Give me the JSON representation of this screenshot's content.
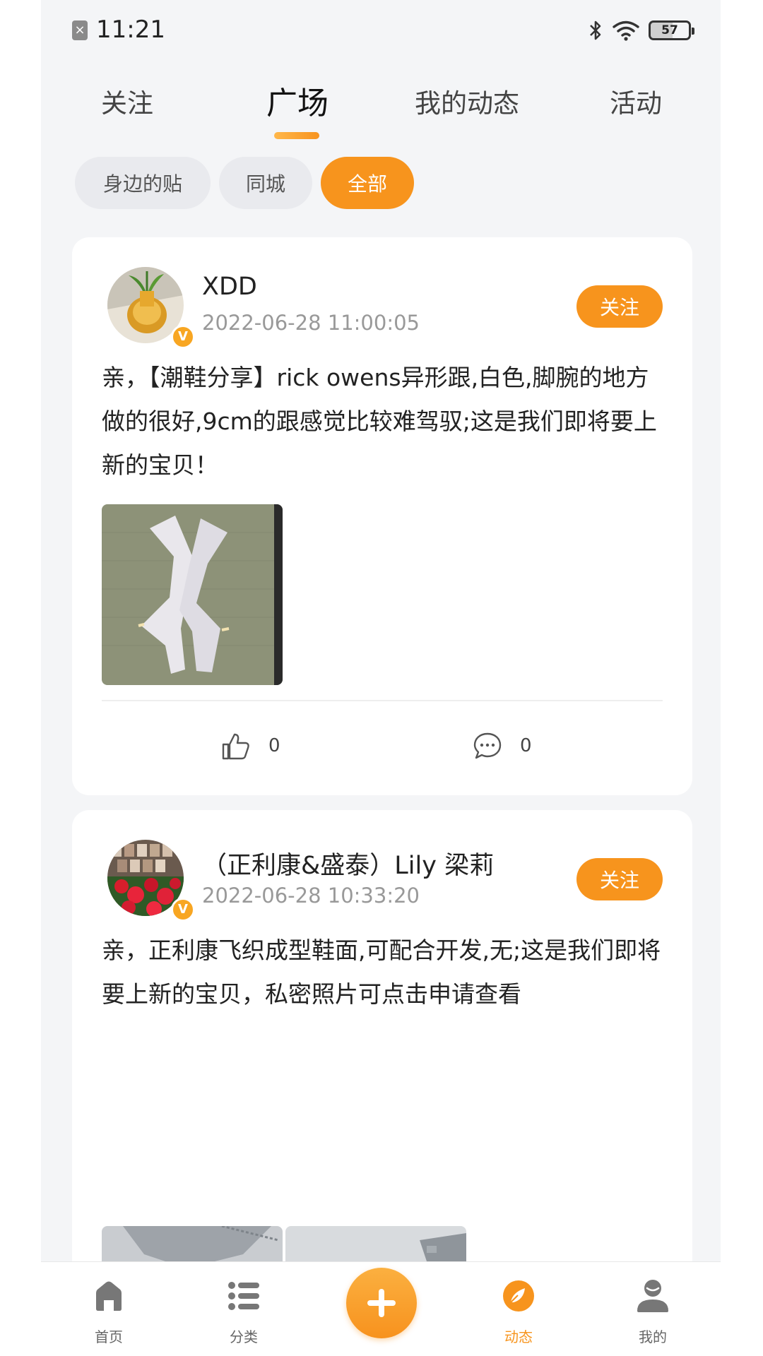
{
  "status_bar": {
    "time": "11:21",
    "battery": "57"
  },
  "top_tabs": [
    {
      "label": "关注",
      "active": false
    },
    {
      "label": "广场",
      "active": true
    },
    {
      "label": "我的动态",
      "active": false
    },
    {
      "label": "活动",
      "active": false
    }
  ],
  "filters": [
    {
      "label": "身边的贴",
      "active": false
    },
    {
      "label": "同城",
      "active": false
    },
    {
      "label": "全部",
      "active": true
    }
  ],
  "posts": [
    {
      "username": "XDD",
      "time": "2022-06-28 11:00:05",
      "follow_label": "关注",
      "verified_badge": "V",
      "text": "亲，【潮鞋分享】rick owens异形跟,白色,脚腕的地方做的很好,9cm的跟感觉比较难驾驭;这是我们即将要上新的宝贝！",
      "likes": "0",
      "comments": "0"
    },
    {
      "username": "（正利康&盛泰）Lily 梁莉",
      "time": "2022-06-28 10:33:20",
      "follow_label": "关注",
      "verified_badge": "V",
      "text": "亲，正利康飞织成型鞋面,可配合开发,无;这是我们即将要上新的宝贝，私密照片可点击申请查看"
    }
  ],
  "bottom_nav": [
    {
      "label": "首页",
      "icon": "home-icon",
      "active": false
    },
    {
      "label": "分类",
      "icon": "list-icon",
      "active": false
    },
    {
      "label": "动态",
      "icon": "feed-icon",
      "active": true
    },
    {
      "label": "我的",
      "icon": "user-icon",
      "active": false
    }
  ],
  "colors": {
    "accent": "#f7941d",
    "background": "#f4f5f7",
    "muted_text": "#999999"
  }
}
